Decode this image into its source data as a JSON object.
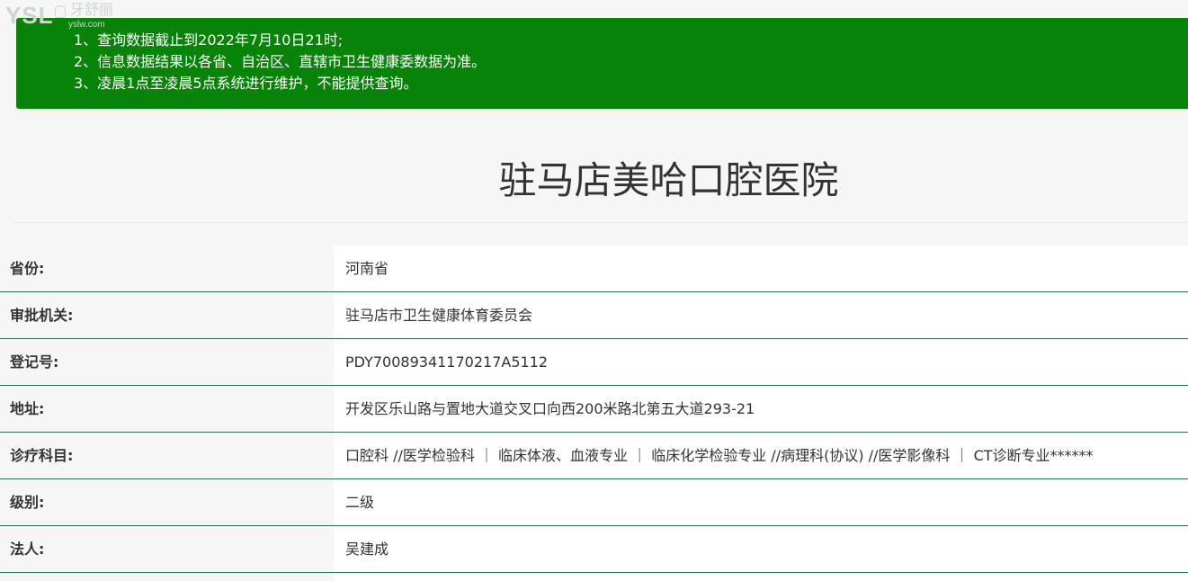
{
  "watermark": {
    "brand": "YSL",
    "chinese_name": "牙舒丽",
    "url": "yslw.com"
  },
  "notice": {
    "lines": [
      "1、查询数据截止到2022年7月10日21时;",
      "2、信息数据结果以各省、自治区、直辖市卫生健康委数据为准。",
      "3、凌晨1点至凌晨5点系统进行维护，不能提供查询。"
    ],
    "background_color": "#078407"
  },
  "hospital": {
    "name": "驻马店美哈口腔医院"
  },
  "info_rows": [
    {
      "label": "省份:",
      "value": "河南省"
    },
    {
      "label": "审批机关:",
      "value": "驻马店市卫生健康体育委员会"
    },
    {
      "label": "登记号:",
      "value": "PDY70089341170217A5112"
    },
    {
      "label": "地址:",
      "value": "开发区乐山路与置地大道交叉口向西200米路北第五大道293-21"
    },
    {
      "label": "诊疗科目:",
      "value": "口腔科 //医学检验科 ｜ 临床体液、血液专业 ｜ 临床化学检验专业 //病理科(协议) //医学影像科 ｜ CT诊断专业******"
    },
    {
      "label": "级别:",
      "value": "二级"
    },
    {
      "label": "法人:",
      "value": "吴建成"
    }
  ],
  "colors": {
    "row_divider": "#2e6e50",
    "label_bg": "#f6f6f6",
    "value_bg": "#ffffff"
  }
}
